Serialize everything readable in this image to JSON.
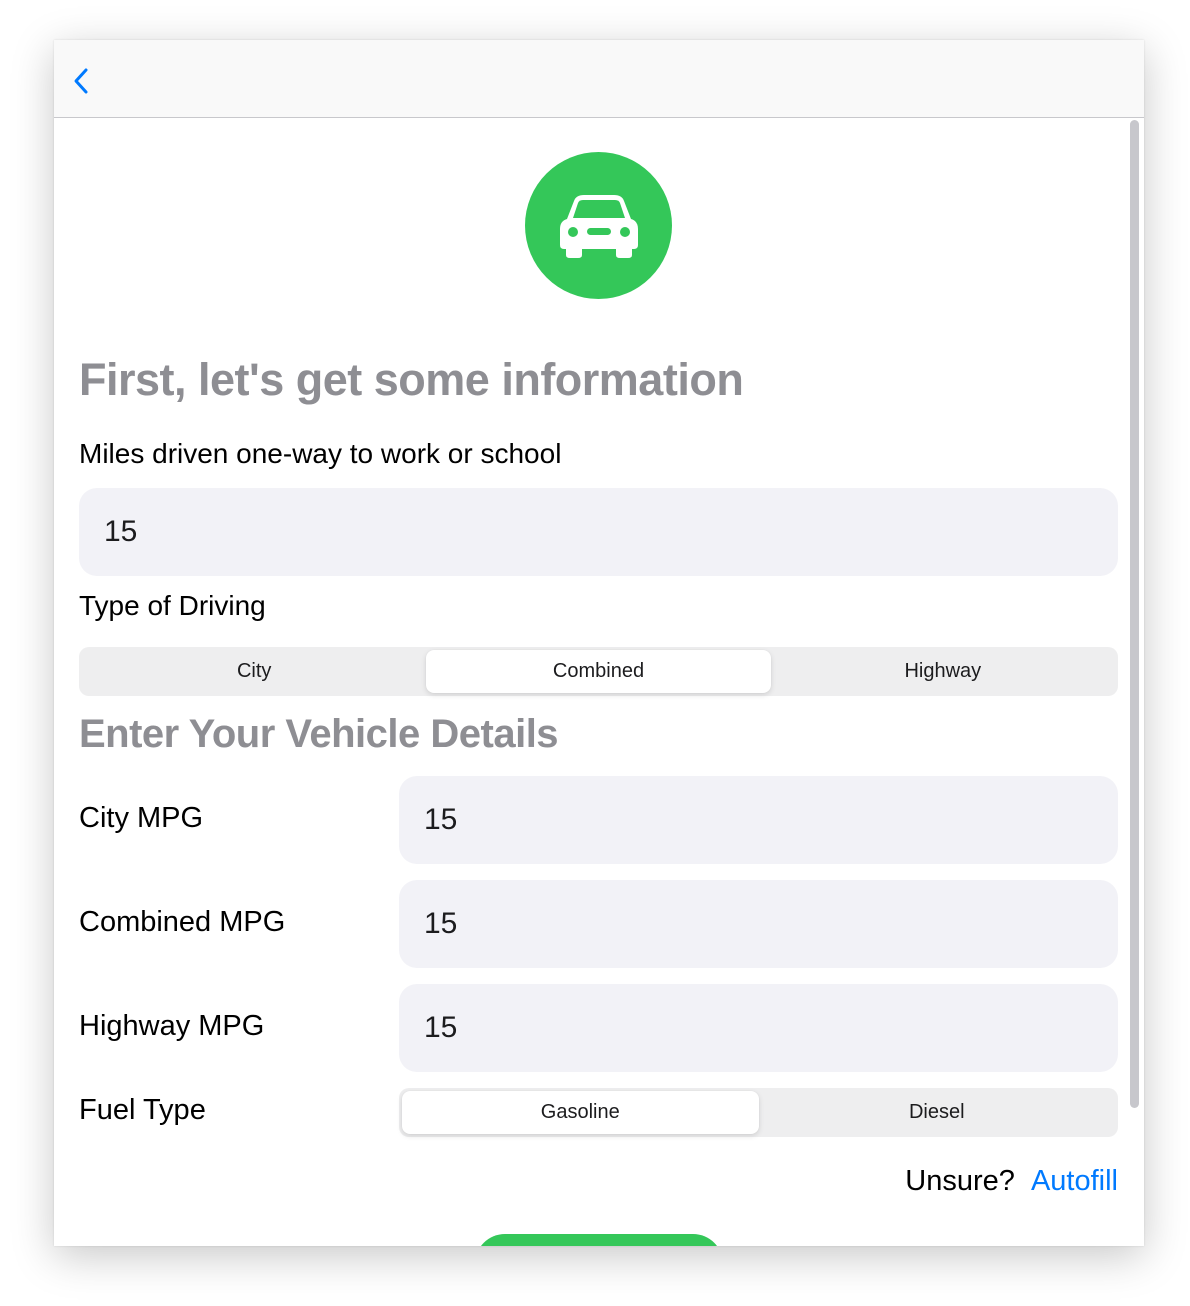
{
  "colors": {
    "accent": "#007aff",
    "brand_green": "#34c759",
    "section_title": "#8e8e93",
    "field_bg": "#f2f2f7"
  },
  "navbar": {
    "back_icon": "chevron-left-icon"
  },
  "hero": {
    "icon": "car-icon"
  },
  "section1": {
    "title": "First, let's get some information",
    "miles_label": "Miles driven one-way to work or school",
    "miles_value": "15",
    "driving_type_label": "Type of Driving",
    "driving_options": [
      "City",
      "Combined",
      "Highway"
    ],
    "driving_selected": "Combined"
  },
  "section2": {
    "title": "Enter Your Vehicle Details",
    "city_mpg_label": "City MPG",
    "city_mpg_value": "15",
    "combined_mpg_label": "Combined MPG",
    "combined_mpg_value": "15",
    "highway_mpg_label": "Highway MPG",
    "highway_mpg_value": "15",
    "fuel_type_label": "Fuel Type",
    "fuel_options": [
      "Gasoline",
      "Diesel"
    ],
    "fuel_selected": "Gasoline"
  },
  "autofill": {
    "prompt": "Unsure?",
    "link": "Autofill"
  }
}
